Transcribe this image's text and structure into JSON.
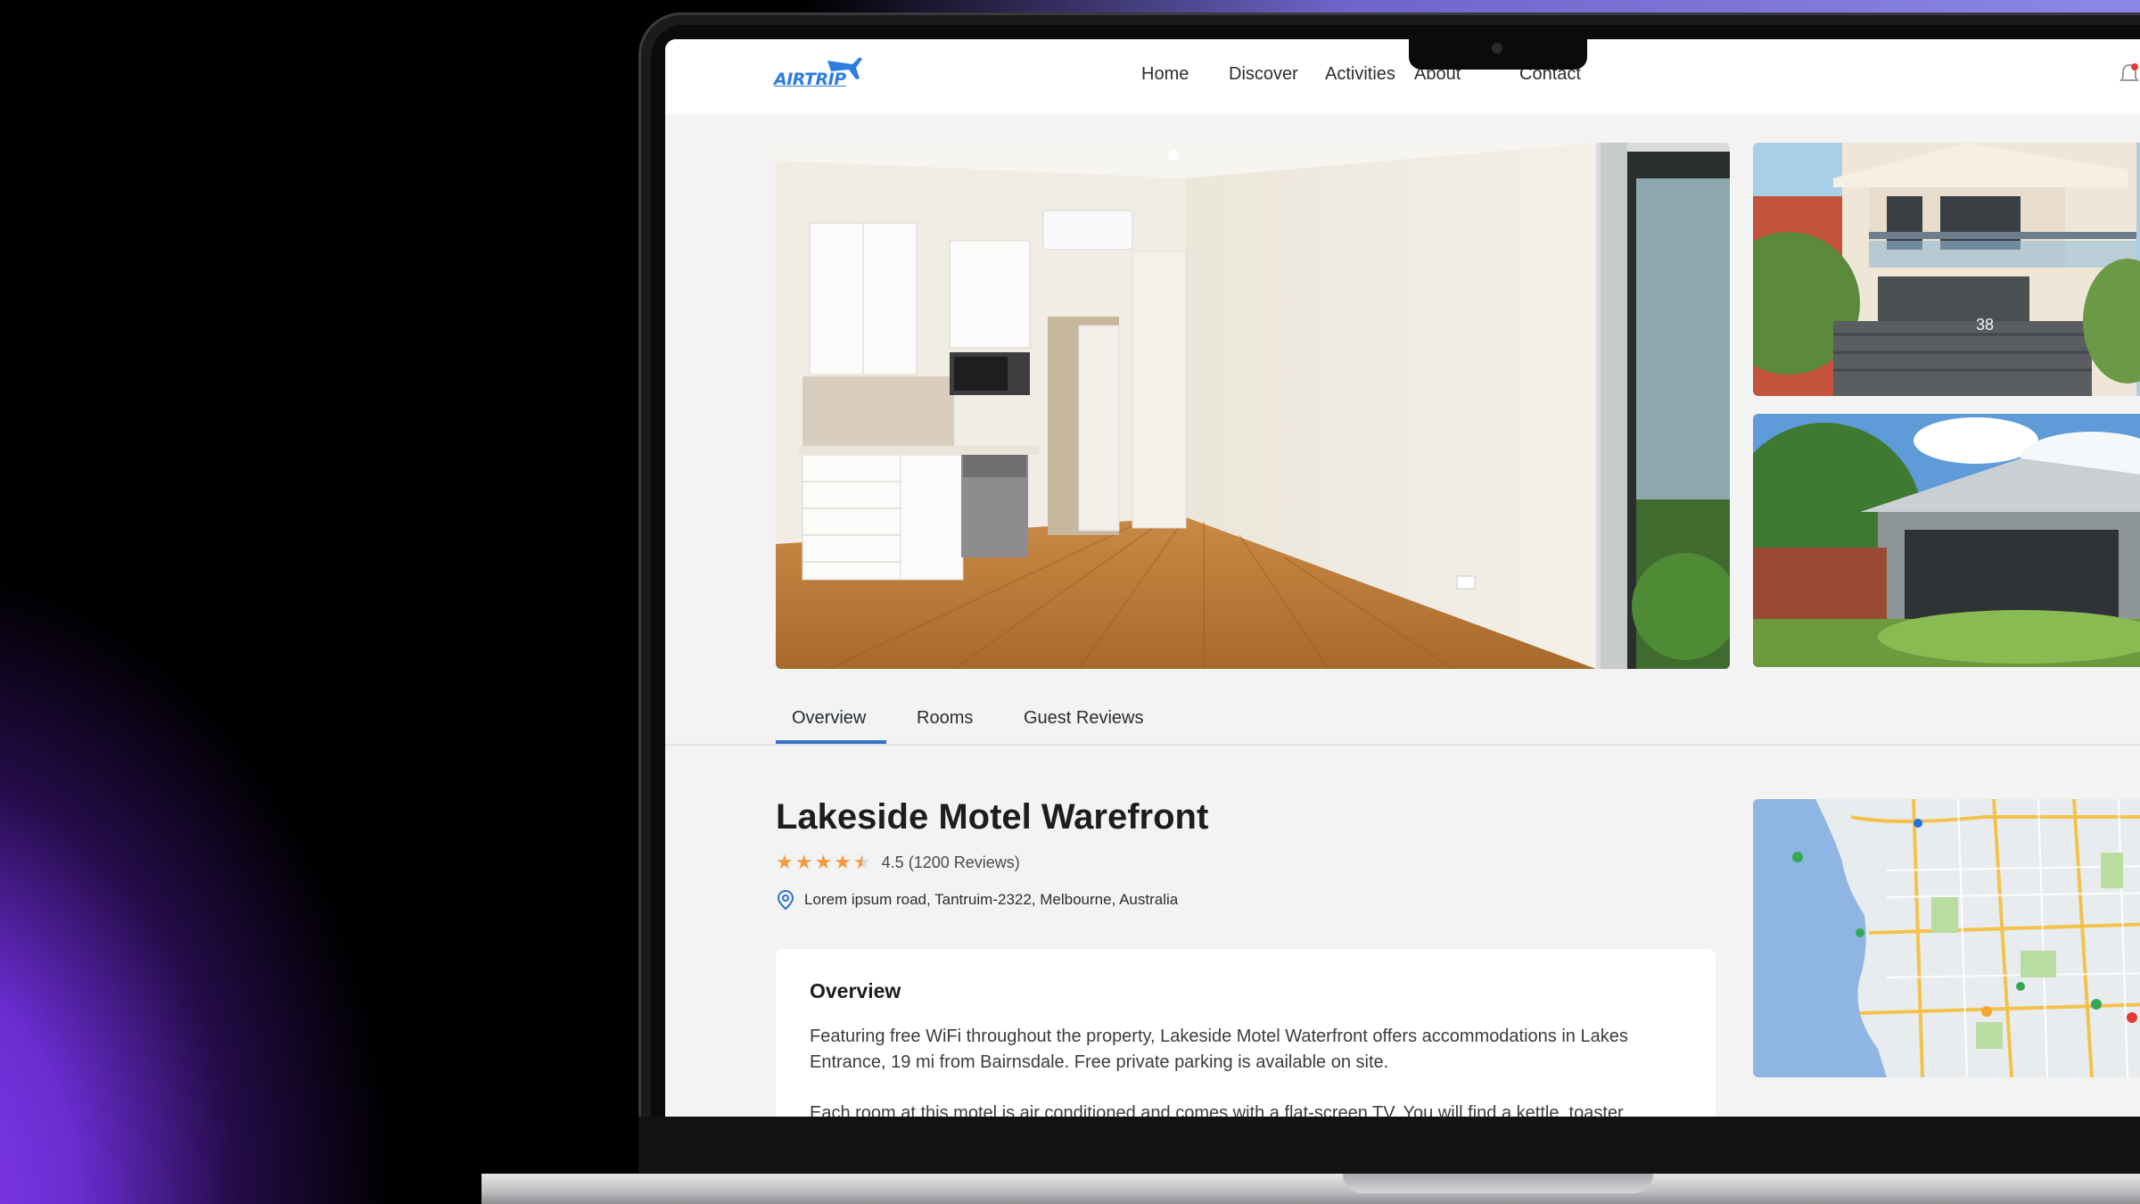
{
  "header": {
    "logo_text": "AIRTRIP",
    "nav": [
      "Home",
      "Discover",
      "Activities",
      "About",
      "Contact"
    ]
  },
  "tabs": [
    "Overview",
    "Rooms",
    "Guest Reviews"
  ],
  "active_tab": "Overview",
  "hotel": {
    "name": "Lakeside Motel Warefront",
    "rating_text": "4.5 (1200 Reviews)",
    "rating_value": 4.5,
    "address": "Lorem ipsum road, Tantruim-2322, Melbourne, Australia"
  },
  "overview": {
    "title": "Overview",
    "paragraph_1": "Featuring free WiFi throughout the property, Lakeside Motel Waterfront offers accommodations in Lakes Entrance, 19 mi from Bairnsdale. Free private parking is available on site.",
    "paragraph_2": "Each room at this motel is air conditioned and comes with a flat-screen TV. You will find a kettle, toaster"
  },
  "gallery": {
    "house_number": "38"
  },
  "colors": {
    "accent": "#2f72c8",
    "star": "#f39a3d",
    "brand": "#2f7de1"
  }
}
